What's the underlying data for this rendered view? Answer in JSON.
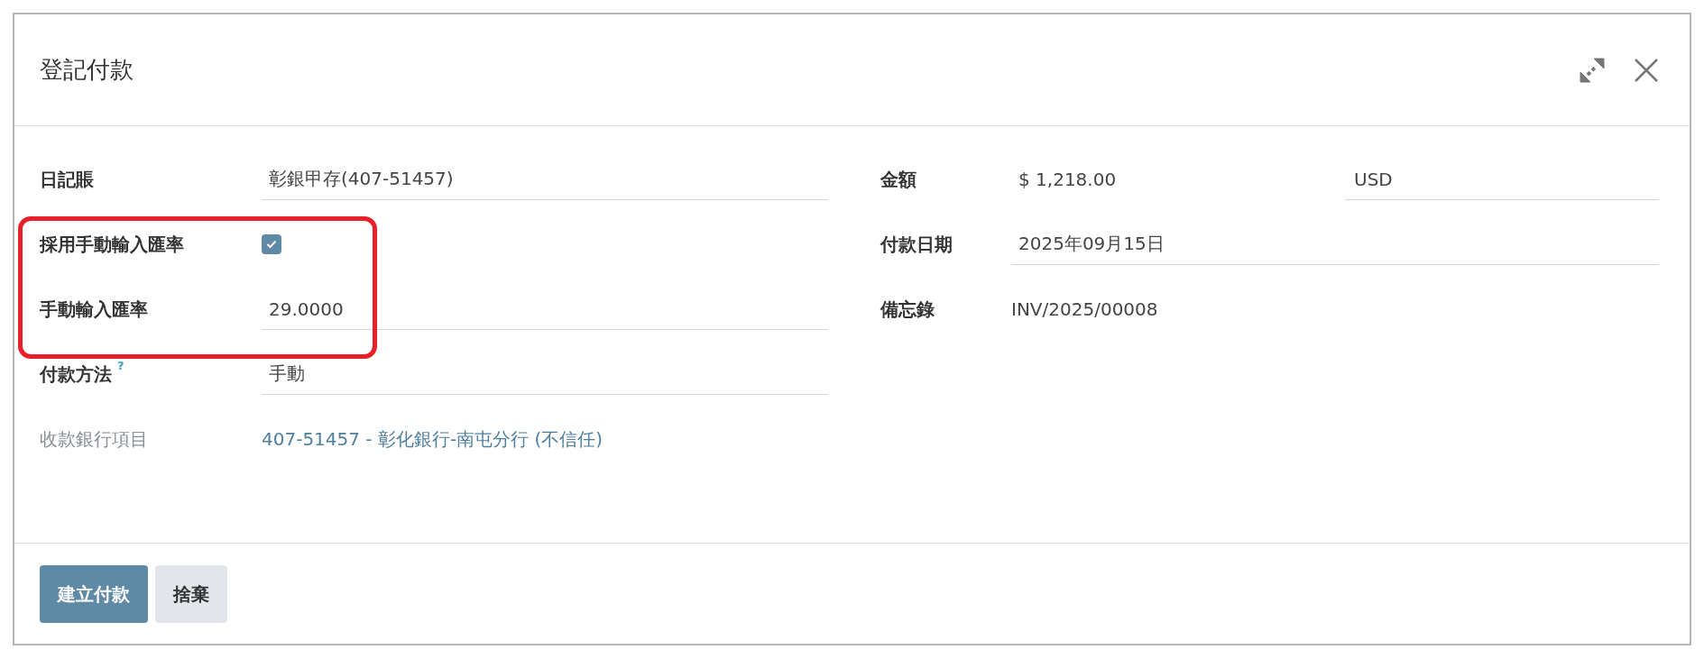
{
  "dialog": {
    "title": "登記付款"
  },
  "left_fields": [
    {
      "kind": "text",
      "label": "日記賬",
      "value": "彰銀甲存(407-51457)"
    },
    {
      "kind": "checkbox",
      "label": "採用手動輸入匯率",
      "checked": true,
      "highlighted": true
    },
    {
      "kind": "text",
      "label": "手動輸入匯率",
      "value": "29.0000",
      "highlighted": true
    },
    {
      "kind": "text",
      "label": "付款方法",
      "help": "?",
      "value": "手動"
    },
    {
      "kind": "link",
      "label": "收款銀行項目",
      "value": "407-51457 - 彰化銀行-南屯分行 (不信任)"
    }
  ],
  "right_fields": [
    {
      "kind": "amount",
      "label": "金額",
      "value": "$ 1,218.00",
      "currency": "USD"
    },
    {
      "kind": "text",
      "label": "付款日期",
      "value": "2025年09月15日"
    },
    {
      "kind": "plain",
      "label": "備忘錄",
      "value": "INV/2025/00008"
    }
  ],
  "buttons": [
    {
      "label": "建立付款",
      "primary": true
    },
    {
      "label": "捨棄",
      "primary": false
    }
  ]
}
